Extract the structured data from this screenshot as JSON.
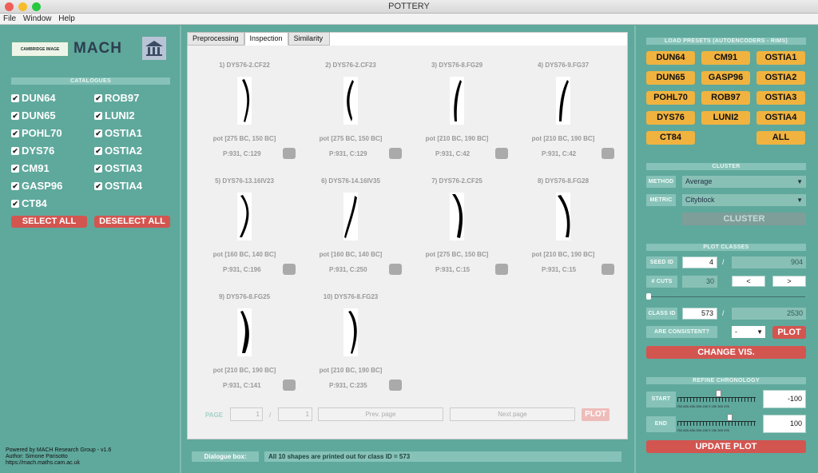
{
  "window": {
    "title": "POTTERY"
  },
  "menu": [
    "File",
    "Window",
    "Help"
  ],
  "left": {
    "logo_text": "CAMBRIDGE IMAGE ANALYSIS",
    "mach_logo": "MACH",
    "catalogues_header": "CATALOGUES",
    "catalogues": [
      {
        "label": "DUN64",
        "checked": true
      },
      {
        "label": "ROB97",
        "checked": true
      },
      {
        "label": "DUN65",
        "checked": true
      },
      {
        "label": "LUNI2",
        "checked": true
      },
      {
        "label": "POHL70",
        "checked": true
      },
      {
        "label": "OSTIA1",
        "checked": true
      },
      {
        "label": "DYS76",
        "checked": true
      },
      {
        "label": "OSTIA2",
        "checked": true
      },
      {
        "label": "CM91",
        "checked": true
      },
      {
        "label": "OSTIA3",
        "checked": true
      },
      {
        "label": "GASP96",
        "checked": true
      },
      {
        "label": "OSTIA4",
        "checked": true
      },
      {
        "label": "CT84",
        "checked": true
      }
    ],
    "select_all": "SELECT ALL",
    "deselect_all": "DESELECT ALL",
    "footer": [
      "Powered by MACH Research Group - v1.6",
      "Author: Simone Parisotto",
      "https://mach.maths.cam.ac.uk"
    ]
  },
  "tabs": [
    "Preprocessing",
    "Inspection",
    "Similarity"
  ],
  "active_tab": "Inspection",
  "shapes": [
    {
      "name": "1) DYS76-2.CF22",
      "period": "pot [275 BC, 150 BC]",
      "pc": "P:931, C:129"
    },
    {
      "name": "2) DYS76-2.CF23",
      "period": "pot [275 BC, 150 BC]",
      "pc": "P:931, C:129"
    },
    {
      "name": "3) DYS76-8.FG29",
      "period": "pot [210 BC, 190 BC]",
      "pc": "P:931, C:42"
    },
    {
      "name": "4) DYS76-9.FG37",
      "period": "pot [210 BC, 190 BC]",
      "pc": "P:931, C:42"
    },
    {
      "name": "5) DYS76-13.16IV23",
      "period": "pot [160 BC, 140 BC]",
      "pc": "P:931, C:196"
    },
    {
      "name": "6) DYS76-14.16IV35",
      "period": "pot [160 BC, 140 BC]",
      "pc": "P:931, C:250"
    },
    {
      "name": "7) DYS76-2.CF25",
      "period": "pot [275 BC, 150 BC]",
      "pc": "P:931, C:15"
    },
    {
      "name": "8) DYS76-8.FG28",
      "period": "pot [210 BC, 190 BC]",
      "pc": "P:931, C:15"
    },
    {
      "name": "9) DYS76-8.FG25",
      "period": "pot [210 BC, 190 BC]",
      "pc": "P:931, C:141"
    },
    {
      "name": "10) DYS76-8.FG23",
      "period": "pot [210 BC, 190 BC]",
      "pc": "P:931, C:235"
    }
  ],
  "pager": {
    "label": "PAGE",
    "current": "1",
    "sep": "/",
    "total": "1",
    "prev": "Prev. page",
    "next": "Next page",
    "plot": "PLOT"
  },
  "dialogue": {
    "label": "Dialogue box:",
    "text": "All 10 shapes are printed out for class ID = 573"
  },
  "right": {
    "presets_header": "LOAD PRESETS (AUTOENCODERS - RIMS)",
    "presets": [
      "DUN64",
      "CM91",
      "OSTIA1",
      "DUN65",
      "GASP96",
      "OSTIA2",
      "POHL70",
      "ROB97",
      "OSTIA3",
      "DYS76",
      "LUNI2",
      "OSTIA4",
      "CT84",
      "ALL"
    ],
    "cluster_header": "CLUSTER",
    "method_label": "METHOD",
    "method_value": "Average",
    "metric_label": "METRIC",
    "metric_value": "Cityblock",
    "cluster_button": "CLUSTER",
    "plot_header": "PLOT CLASSES",
    "seed_label": "SEED ID",
    "seed_value": "4",
    "seed_max": "904",
    "cuts_label": "# CUTS",
    "cuts_value": "30",
    "prev_btn": "<",
    "next_btn": ">",
    "class_label": "CLASS ID",
    "class_value": "573",
    "class_max": "2530",
    "consistent_label": "ARE CONSISTENT?",
    "consistent_value": "-",
    "plot_button": "PLOT",
    "change_vis": "CHANGE VIS.",
    "refine_header": "REFINE CHRONOLOGY",
    "start_label": "START",
    "start_value": "-100",
    "end_label": "END",
    "end_value": "100",
    "axis_ticks": "-752-600-450-300-150  0  150  300  476",
    "update_plot": "UPDATE PLOT"
  },
  "colors": {
    "bg": "#5fa89c",
    "red": "#d35550",
    "yellow": "#f1b33f"
  }
}
